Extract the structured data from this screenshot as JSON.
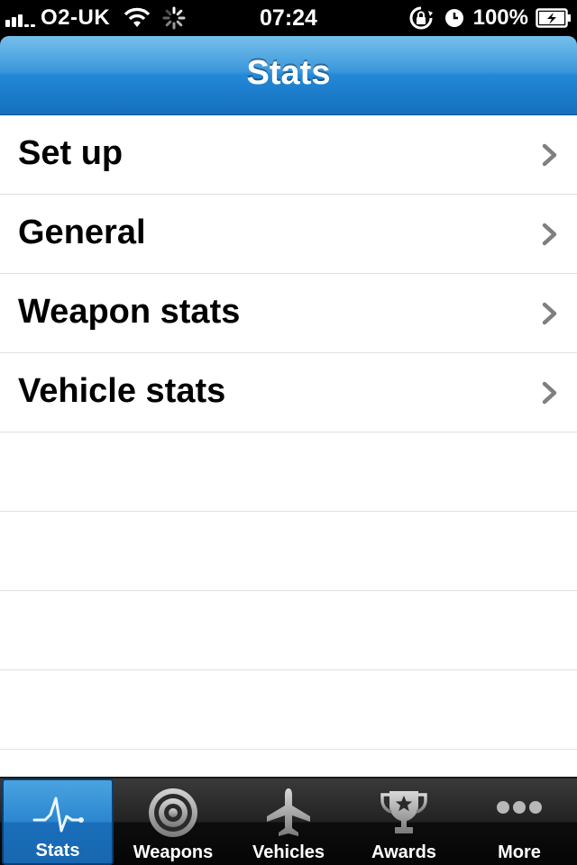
{
  "status_bar": {
    "carrier": "O2-UK",
    "time": "07:24",
    "battery_percent": "100%"
  },
  "nav": {
    "title": "Stats"
  },
  "rows": [
    {
      "label": "Set up"
    },
    {
      "label": "General"
    },
    {
      "label": "Weapon stats"
    },
    {
      "label": "Vehicle stats"
    }
  ],
  "empty_rows": 4,
  "tabs": [
    {
      "label": "Stats",
      "icon": "pulse-icon",
      "selected": true
    },
    {
      "label": "Weapons",
      "icon": "target-icon",
      "selected": false
    },
    {
      "label": "Vehicles",
      "icon": "airplane-icon",
      "selected": false
    },
    {
      "label": "Awards",
      "icon": "trophy-icon",
      "selected": false
    },
    {
      "label": "More",
      "icon": "more-dots-icon",
      "selected": false
    }
  ],
  "colors": {
    "nav_blue": "#2288d6",
    "tab_selected_blue": "#2b86cf",
    "chevron_gray": "#7f7f7f"
  }
}
